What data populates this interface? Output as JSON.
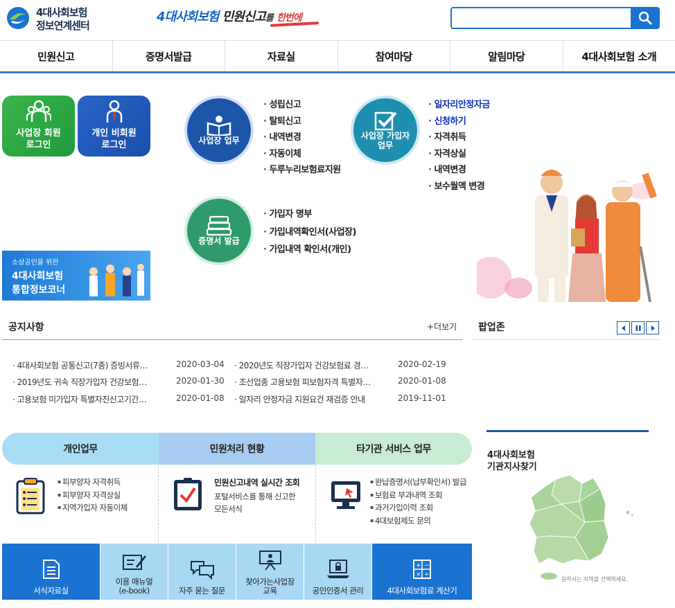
{
  "header": {
    "logo_line1": "4대사회보험",
    "logo_line2": "정보연계센터",
    "slogan_part1": "4대사회보험",
    "slogan_part2": "민원신고",
    "slogan_part3": "를",
    "slogan_part4": "한번에",
    "search_placeholder": "",
    "search_value": ""
  },
  "nav": {
    "items": [
      "민원신고",
      "증명서발급",
      "자료실",
      "참여마당",
      "알림마당",
      "4대사회보험 소개"
    ]
  },
  "login": {
    "biz_line1": "사업장 회원",
    "biz_line2": "로그인",
    "person_line1": "개인 비회원",
    "person_line2": "로그인"
  },
  "banner": {
    "small": "소상공인을 위한",
    "big1": "4대사회보험",
    "big2": "통합정보코너"
  },
  "services_circles": {
    "biz": {
      "label": "사업장 업무",
      "links": [
        "성립신고",
        "탈퇴신고",
        "내역변경",
        "자동이체",
        "두루누리보험료지원"
      ]
    },
    "join": {
      "label_line1": "사업장 가입자",
      "label_line2": "업무",
      "links": [
        "일자리안정자금",
        "신청하기",
        "자격취득",
        "자격상실",
        "내역변경",
        "보수월액 변경"
      ]
    },
    "cert": {
      "label": "증명서 발급",
      "links": [
        "가입자 명부",
        "가입내역확인서(사업장)",
        "가입내역 확인서(개인)"
      ]
    }
  },
  "notice": {
    "title": "공지사항",
    "more": "+더보기",
    "left": [
      {
        "text": "4대사회보험 공통신고(7종) 증빙서류…",
        "date": "2020-03-04"
      },
      {
        "text": "2019년도 귀속 직장가입자 건강보험…",
        "date": "2020-01-30"
      },
      {
        "text": "고용보험 미가입자 특별자진신고기간…",
        "date": "2020-01-08"
      }
    ],
    "right": [
      {
        "text": "2020년도 직장가입자 건강보험료 경…",
        "date": "2020-02-19"
      },
      {
        "text": "조선업종 고용보험 피보험자격 특별자…",
        "date": "2020-01-08"
      },
      {
        "text": "일자리 안정자금 지원요건 재검증 안내",
        "date": "2019-11-01"
      }
    ]
  },
  "popup": {
    "title": "팝업존"
  },
  "service_tabs": {
    "tab1": "개인업무",
    "tab2": "민원처리 현황",
    "tab3": "타기관 서비스 업무",
    "col1": [
      "피부양자 자격취득",
      "피부양자 자격상실",
      "지역가입자 자동이체"
    ],
    "col2_title": "민원신고내역 실시간 조회",
    "col2_desc1": "포털서비스를 통해 신고한",
    "col2_desc2": "모든서식",
    "col3": [
      "완납증명서(납부확인서) 발급",
      "보험료 부과내역 조회",
      "과거가입이력 조회",
      "4대보험제도 문의"
    ]
  },
  "quick_menu": {
    "items": [
      {
        "line1": "서식자료실",
        "line2": ""
      },
      {
        "line1": "이용 매뉴얼",
        "line2": "(e-book)"
      },
      {
        "line1": "자주 묻는 질문",
        "line2": ""
      },
      {
        "line1": "찾아가는사업장",
        "line2": "교육"
      },
      {
        "line1": "공인인증서 관리",
        "line2": ""
      },
      {
        "line1": "4대사회보험료 계산기",
        "line2": ""
      }
    ]
  },
  "map": {
    "title1": "4대사회보험",
    "title2": "기관지사찾기",
    "caption": "원하시는 지역을 선택하세요."
  },
  "colors": {
    "primary": "#1b73d1",
    "nav_border": "#3b80c4",
    "green": "#1f9a3a",
    "highlight_link": "#0d2fb8"
  }
}
